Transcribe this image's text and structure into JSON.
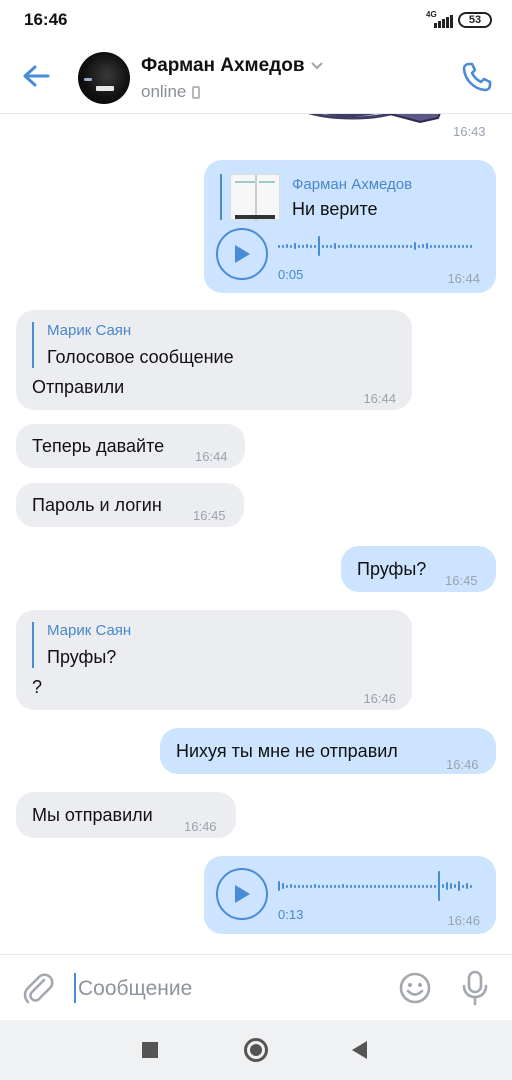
{
  "status_bar": {
    "time": "16:46",
    "network": "4G",
    "battery": "53"
  },
  "header": {
    "contact_name": "Фарман Ахмедов",
    "contact_status": "online"
  },
  "messages": [
    {
      "type": "sticker",
      "direction": "in",
      "time": "16:43"
    },
    {
      "type": "voice_reply",
      "direction": "out",
      "reply_author": "Фарман Ахмедов",
      "reply_text": "Ни верите",
      "duration": "0:05",
      "time": "16:44"
    },
    {
      "type": "text_reply",
      "direction": "in",
      "reply_author": "Марик Саян",
      "reply_text": "Голосовое сообщение",
      "text": "Отправили",
      "time": "16:44"
    },
    {
      "type": "text",
      "direction": "in",
      "text": "Теперь давайте",
      "time": "16:44"
    },
    {
      "type": "text",
      "direction": "in",
      "text": "Пароль и логин",
      "time": "16:45"
    },
    {
      "type": "text",
      "direction": "out",
      "text": "Пруфы?",
      "time": "16:45"
    },
    {
      "type": "text_reply",
      "direction": "in",
      "reply_author": "Марик Саян",
      "reply_text": "Пруфы?",
      "text": "?",
      "time": "16:46"
    },
    {
      "type": "text",
      "direction": "out",
      "text": "Нихуя ты мне не отправил",
      "time": "16:46"
    },
    {
      "type": "text",
      "direction": "in",
      "text": "Мы отправили",
      "time": "16:46"
    },
    {
      "type": "voice",
      "direction": "out",
      "duration": "0:13",
      "time": "16:46"
    }
  ],
  "input": {
    "placeholder": "Сообщение",
    "value": ""
  },
  "icons": {
    "back": "arrow-left-icon",
    "call": "phone-icon",
    "attach": "paperclip-icon",
    "emoji": "smiley-icon",
    "mic": "microphone-icon",
    "play": "play-icon"
  },
  "colors": {
    "accent": "#4a8bd6",
    "outgoing_bubble": "#cce4ff",
    "incoming_bubble": "#ebedf0",
    "time_text": "#9aa3ad"
  }
}
